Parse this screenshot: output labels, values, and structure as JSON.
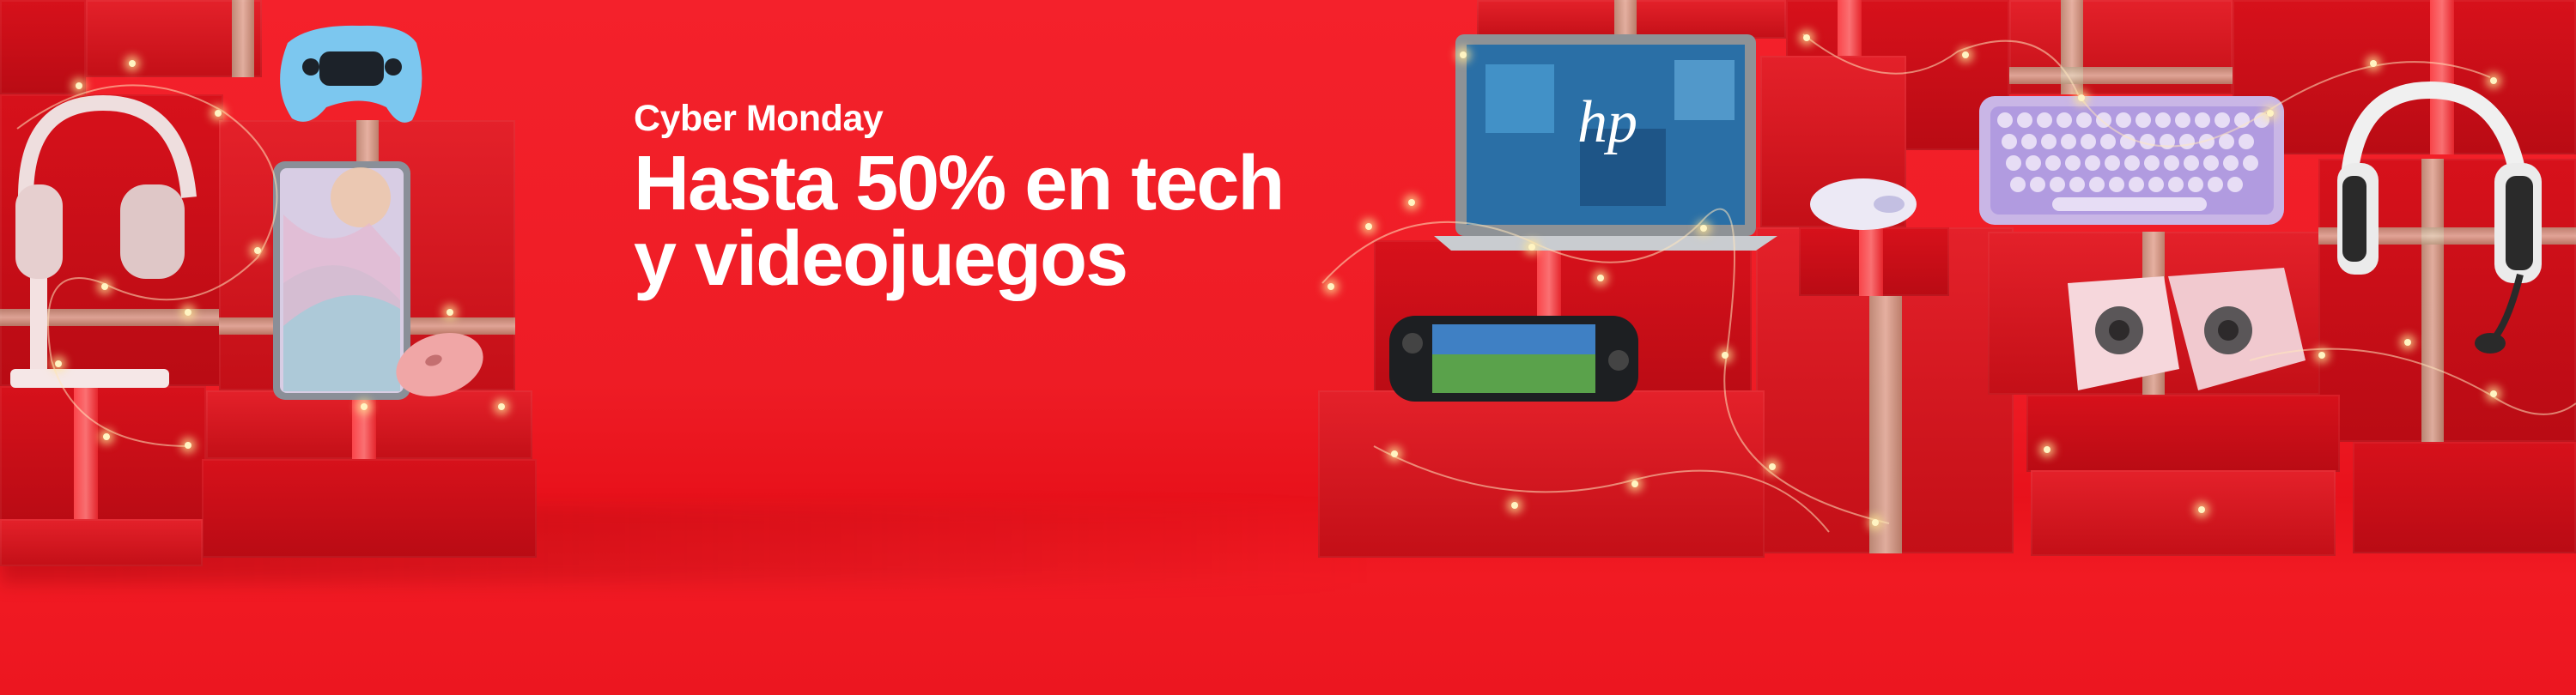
{
  "banner": {
    "kicker": "Cyber Monday",
    "headline_line1": "Hasta 50% en tech",
    "headline_line2": "y videojuegos"
  },
  "products": {
    "laptop_logo": "hp"
  },
  "colors": {
    "background": "#ee1c25",
    "text": "#ffffff",
    "gift_wrap": "#c8101a",
    "ribbon_gold": "#d8c2a8"
  },
  "icons": [
    "headphones-stand-icon",
    "gamepad-icon",
    "tablet-icon",
    "mouse-icon",
    "laptop-icon",
    "handheld-console-icon",
    "keyboard-icon",
    "speakers-icon",
    "headset-icon"
  ]
}
